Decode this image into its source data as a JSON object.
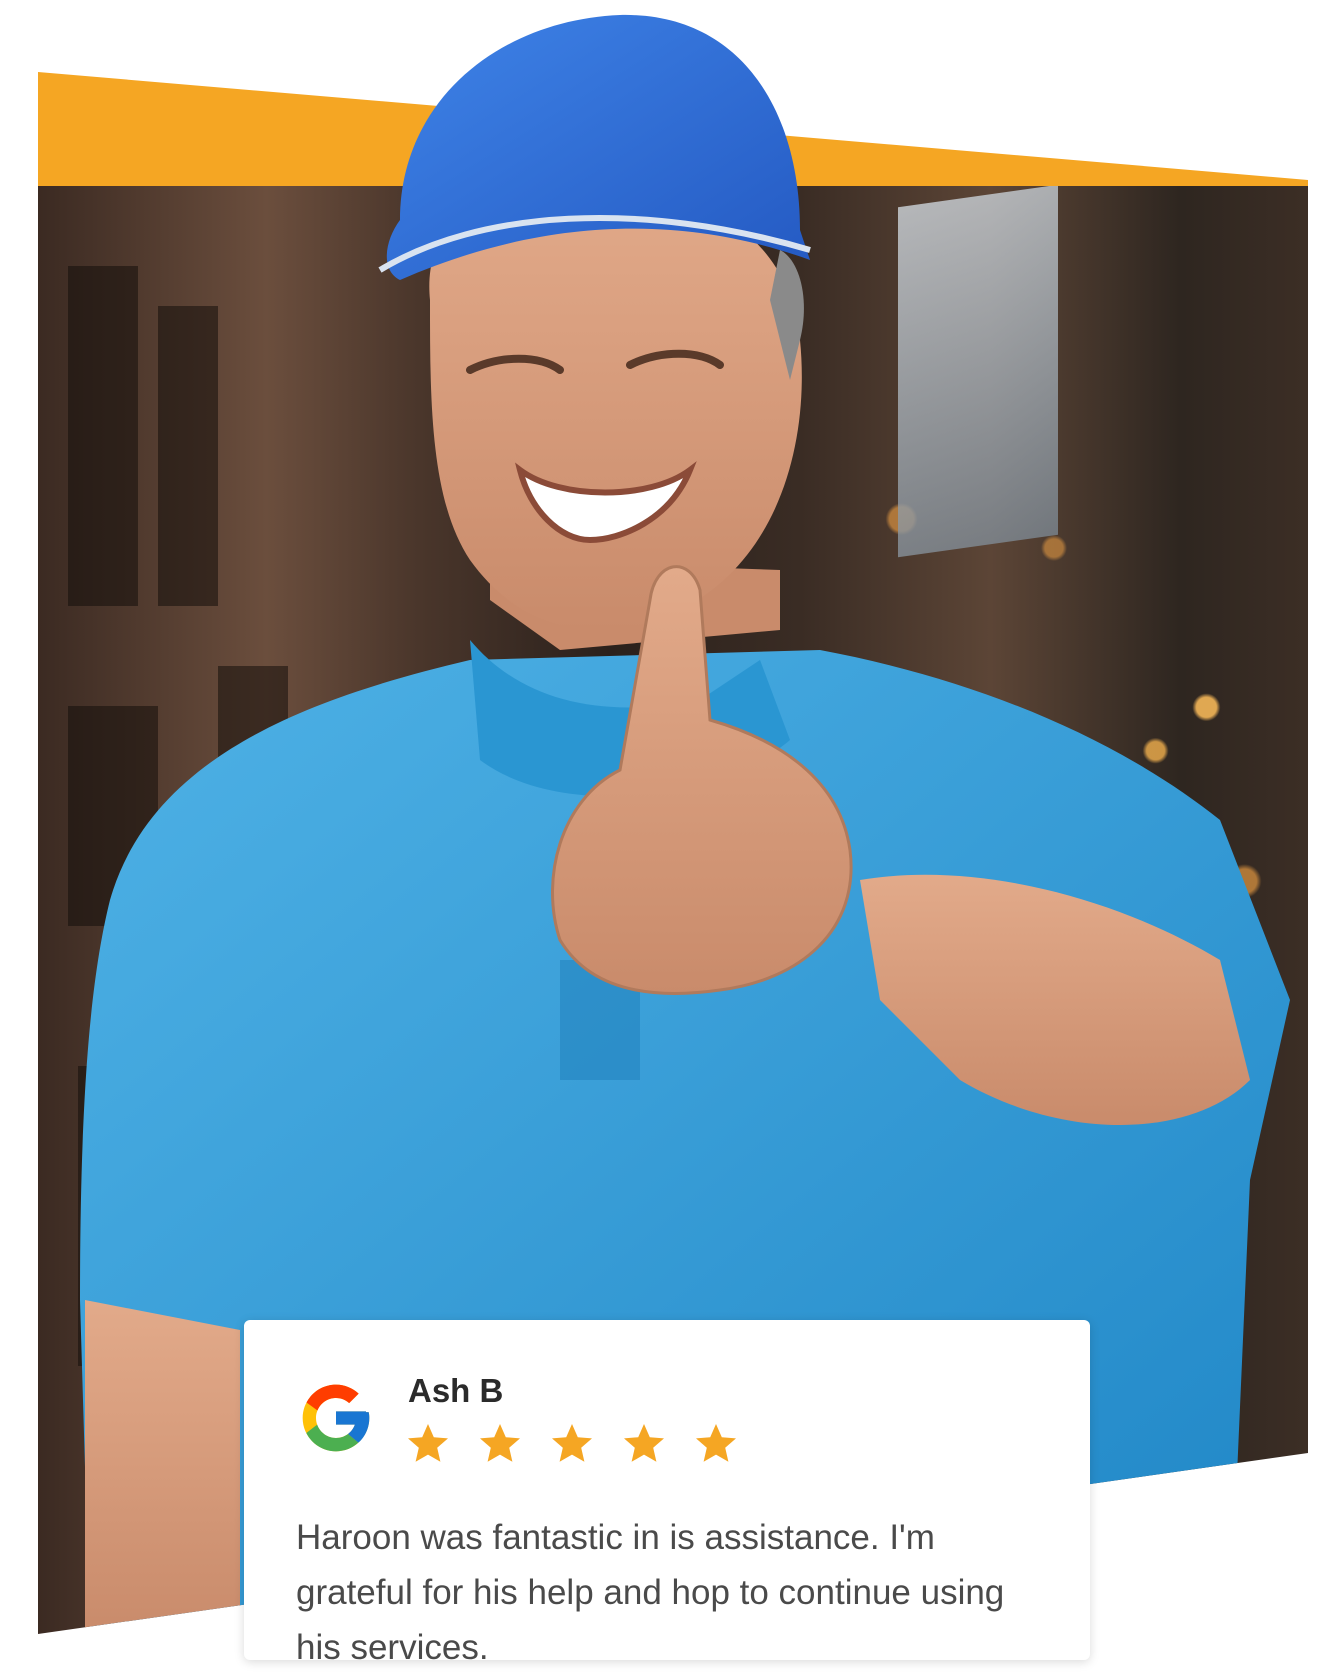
{
  "review": {
    "name": "Ash B",
    "rating": 5,
    "text": "Haroon was fantastic in is assistance. I'm grateful for his help and hop to continue using his services."
  },
  "icons": {
    "logo": "google-g-logo",
    "star": "star-icon",
    "photo": "technician-thumbs-up-photo"
  },
  "colors": {
    "accent": "#F5A623",
    "star": "#F5A623",
    "shirt": "#2E9BD6",
    "cap": "#2F6FD9"
  }
}
